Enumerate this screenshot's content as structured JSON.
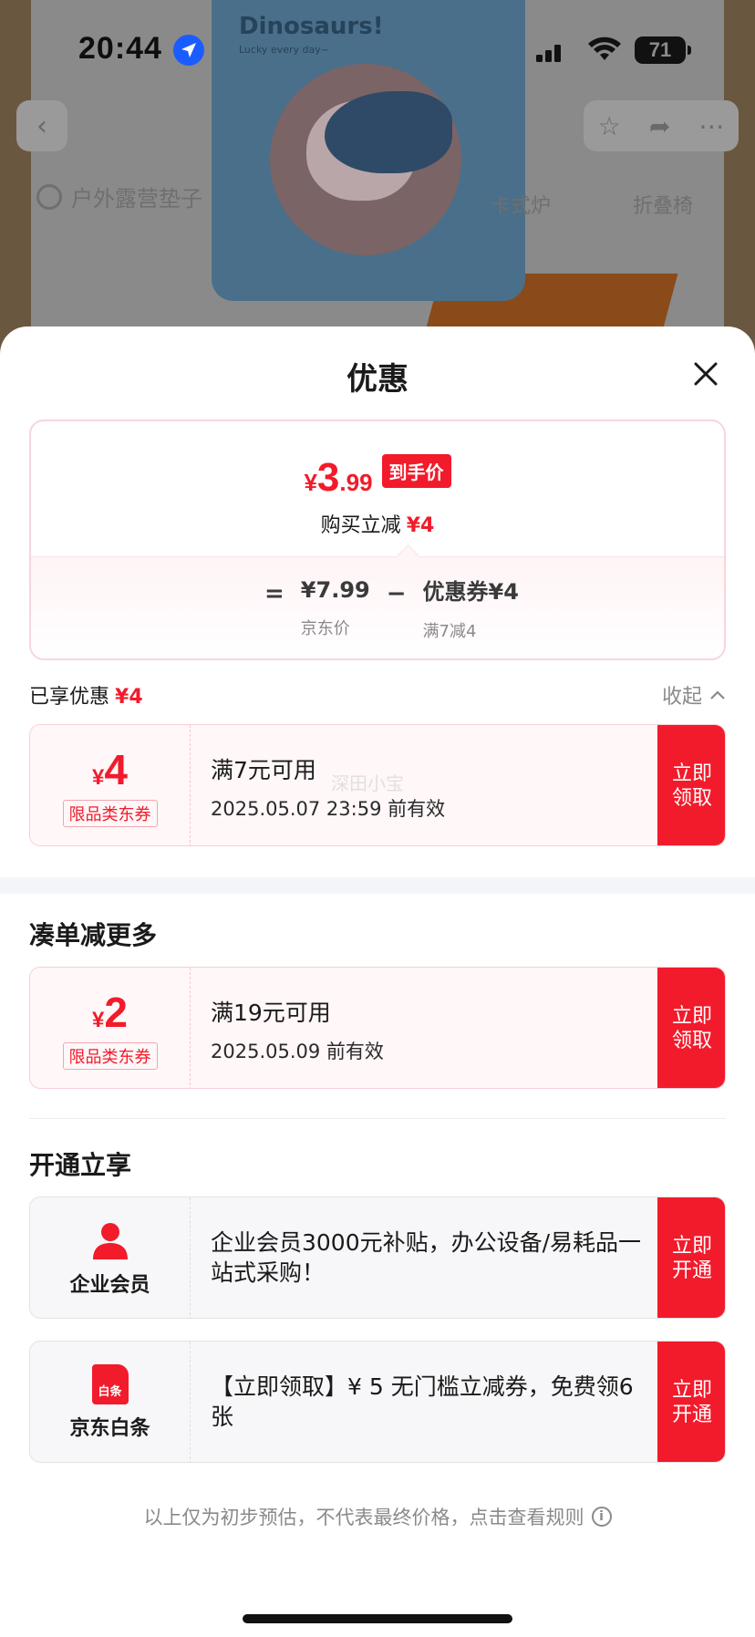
{
  "status_bar": {
    "time": "20:44",
    "battery": "71",
    "icons": [
      "location-arrow-icon",
      "cellular-signal-icon",
      "wifi-icon",
      "battery-icon"
    ]
  },
  "background": {
    "product_card_title": "Dinosaurs!",
    "product_card_subtitle": "Lucky every day~",
    "search_text": "户外露营垫子",
    "tabs": [
      "卡式炉",
      "折叠椅"
    ]
  },
  "sheet": {
    "title": "优惠",
    "close_icon": "close-icon"
  },
  "price_card": {
    "currency": "¥",
    "final_int": "3",
    "final_dec": ".99",
    "badge": "到手价",
    "discount_label": "购买立减",
    "discount_value": "¥4",
    "formula": {
      "equals": "=",
      "jd_price": "¥7.99",
      "jd_price_label": "京东价",
      "minus": "−",
      "coupon": "优惠券¥4",
      "coupon_rule": "满7减4"
    }
  },
  "enjoyed": {
    "label": "已享优惠",
    "value": "¥4",
    "collapse": "收起"
  },
  "coupons_enjoyed": [
    {
      "currency": "¥",
      "value": "4",
      "type": "限品类东券",
      "condition": "满7元可用",
      "expire": "2025.05.07 23:59 前有效",
      "button": "立即领取",
      "watermark": "深田小宝"
    }
  ],
  "section_more": {
    "title": "凑单减更多",
    "coupons": [
      {
        "currency": "¥",
        "value": "2",
        "type": "限品类东券",
        "condition": "满19元可用",
        "expire": "2025.05.09 前有效",
        "button": "立即领取"
      }
    ]
  },
  "section_open": {
    "title": "开通立享",
    "items": [
      {
        "icon": "person-icon",
        "label": "企业会员",
        "desc": " 企业会员3000元补贴，办公设备/易耗品一站式采购！",
        "button": "立即开通"
      },
      {
        "icon": "baitiao-icon",
        "icon_text": "白条",
        "label": "京东白条",
        "desc": "【立即领取】¥ 5 无门槛立减券，免费领6张",
        "button": "立即开通"
      }
    ]
  },
  "footer": {
    "note": "以上仅为初步预估，不代表最终价格，点击查看规则",
    "icon": "info-icon"
  },
  "colors": {
    "accent_red": "#f21b2b",
    "coupon_bg": "#fff7f8",
    "coupon_border": "#f7d0d7"
  }
}
